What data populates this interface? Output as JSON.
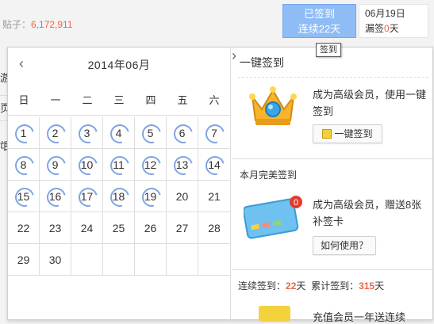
{
  "topbar": {
    "posts_label": "贴子：",
    "posts_count": "6,172,911",
    "signed_line1": "已签到",
    "signed_line2": "连续22天",
    "date": "06月19日",
    "leak_label": "漏签",
    "leak_count": "0",
    "leak_unit": "天",
    "tooltip": "签到"
  },
  "side": {
    "char1": "游",
    "char2": "页",
    "char3": "氓"
  },
  "calendar": {
    "month": "2014年06月",
    "prev": "‹",
    "next": "›",
    "weekdays": [
      "日",
      "一",
      "二",
      "三",
      "四",
      "五",
      "六"
    ],
    "rows": [
      [
        "1",
        "2",
        "3",
        "4",
        "5",
        "6",
        "7"
      ],
      [
        "8",
        "9",
        "10",
        "11",
        "12",
        "13",
        "14"
      ],
      [
        "15",
        "16",
        "17",
        "18",
        "19",
        "20",
        "21"
      ],
      [
        "22",
        "23",
        "24",
        "25",
        "26",
        "27",
        "28"
      ],
      [
        "29",
        "30",
        "",
        "",
        "",
        "",
        ""
      ]
    ],
    "signed_days": [
      "1",
      "2",
      "3",
      "4",
      "5",
      "6",
      "7",
      "8",
      "9",
      "10",
      "11",
      "12",
      "13",
      "14",
      "15",
      "16",
      "17",
      "18",
      "19"
    ]
  },
  "right": {
    "onekey_title": "一键签到",
    "onekey_text": "成为高级会员，使用一键签到",
    "onekey_button": "一键签到",
    "month_title": "本月完美签到",
    "card_text": "成为高级会员，赠送8张补签卡",
    "card_badge": "0",
    "how_button": "如何使用？",
    "stats_continuous_label": "连续签到：",
    "stats_continuous": "22",
    "stats_total_label": "累计签到：",
    "stats_total": "315",
    "day_unit": "天",
    "bottom_text": "充值会员一年送连续"
  },
  "colors": {
    "accent_orange": "#e96846",
    "signed_blue": "#8fbcf5",
    "ring_blue": "#7ea5e0"
  }
}
